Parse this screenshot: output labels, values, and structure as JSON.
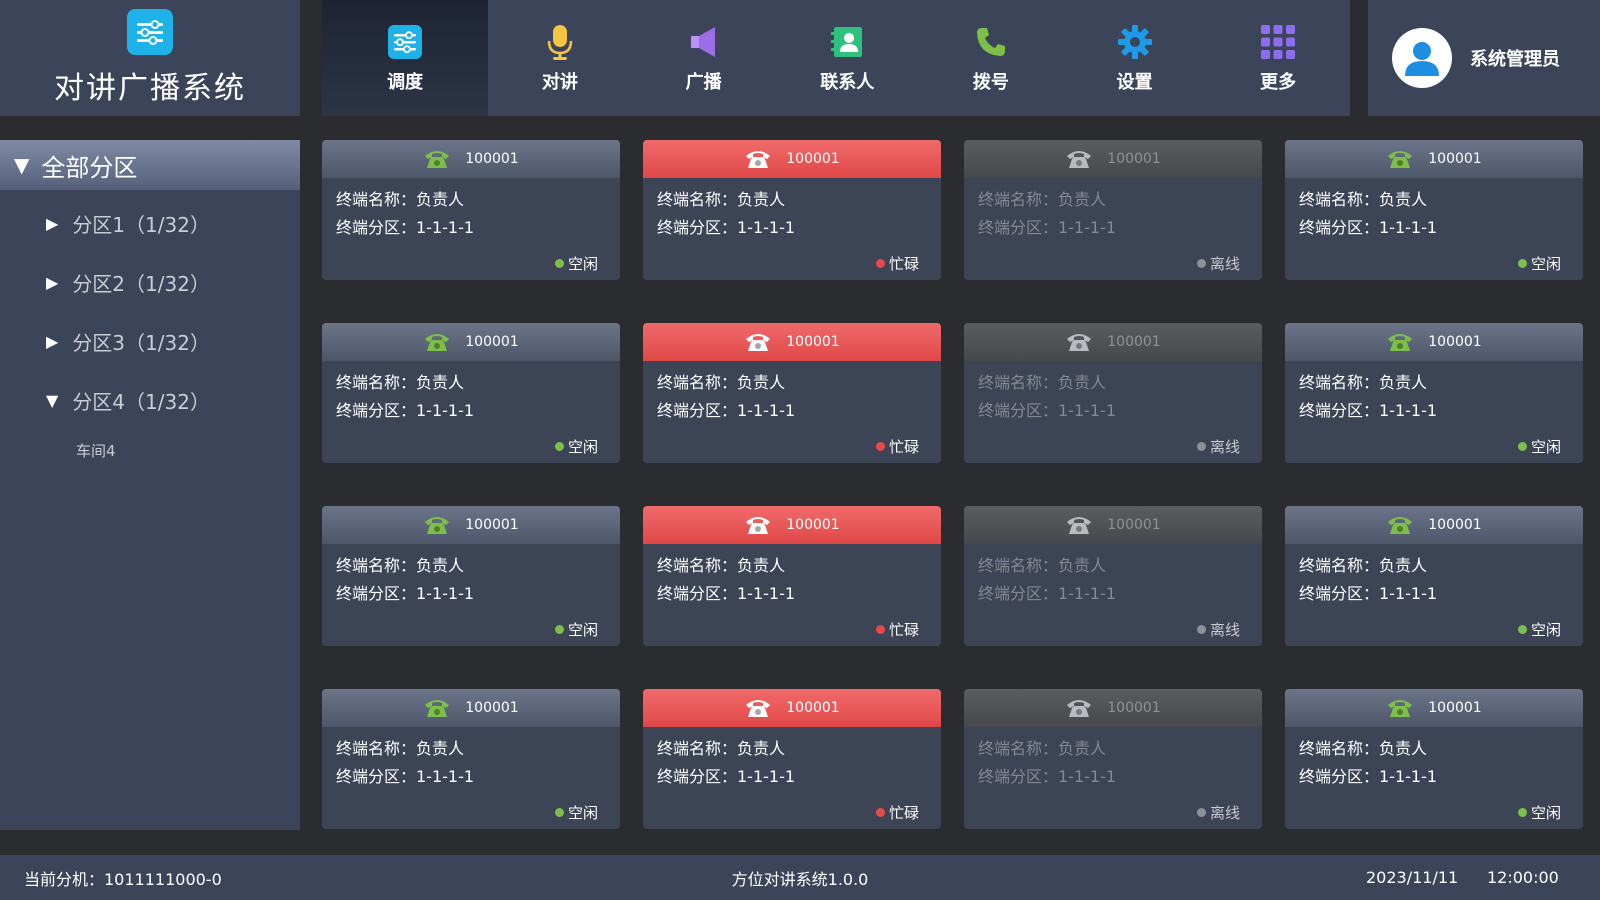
{
  "app": {
    "title": "对讲广播系统"
  },
  "nav": [
    {
      "label": "调度",
      "icon": "dispatch-icon",
      "active": true
    },
    {
      "label": "对讲",
      "icon": "microphone-icon"
    },
    {
      "label": "广播",
      "icon": "speaker-icon"
    },
    {
      "label": "联系人",
      "icon": "contacts-icon"
    },
    {
      "label": "拨号",
      "icon": "phone-dial-icon"
    },
    {
      "label": "设置",
      "icon": "gear-icon"
    },
    {
      "label": "更多",
      "icon": "grid-icon"
    }
  ],
  "user": {
    "name": "系统管理员",
    "icon": "user-avatar-icon"
  },
  "sidebar": {
    "root": "全部分区",
    "items": [
      {
        "label": "分区1（1/32）",
        "expanded": false
      },
      {
        "label": "分区2（1/32）",
        "expanded": false
      },
      {
        "label": "分区3（1/32）",
        "expanded": false
      },
      {
        "label": "分区4（1/32）",
        "expanded": true
      }
    ],
    "leaf": "车间4"
  },
  "cards": [
    {
      "id": "100001",
      "name_line": "终端名称：负责人",
      "zone_line": "终端分区：1-1-1-1",
      "status": "空闲",
      "state": "idle"
    },
    {
      "id": "100001",
      "name_line": "终端名称：负责人",
      "zone_line": "终端分区：1-1-1-1",
      "status": "忙碌",
      "state": "busy"
    },
    {
      "id": "100001",
      "name_line": "终端名称：负责人",
      "zone_line": "终端分区：1-1-1-1",
      "status": "离线",
      "state": "offline"
    },
    {
      "id": "100001",
      "name_line": "终端名称：负责人",
      "zone_line": "终端分区：1-1-1-1",
      "status": "空闲",
      "state": "idle"
    },
    {
      "id": "100001",
      "name_line": "终端名称：负责人",
      "zone_line": "终端分区：1-1-1-1",
      "status": "空闲",
      "state": "idle"
    },
    {
      "id": "100001",
      "name_line": "终端名称：负责人",
      "zone_line": "终端分区：1-1-1-1",
      "status": "忙碌",
      "state": "busy"
    },
    {
      "id": "100001",
      "name_line": "终端名称：负责人",
      "zone_line": "终端分区：1-1-1-1",
      "status": "离线",
      "state": "offline"
    },
    {
      "id": "100001",
      "name_line": "终端名称：负责人",
      "zone_line": "终端分区：1-1-1-1",
      "status": "空闲",
      "state": "idle"
    },
    {
      "id": "100001",
      "name_line": "终端名称：负责人",
      "zone_line": "终端分区：1-1-1-1",
      "status": "空闲",
      "state": "idle"
    },
    {
      "id": "100001",
      "name_line": "终端名称：负责人",
      "zone_line": "终端分区：1-1-1-1",
      "status": "忙碌",
      "state": "busy"
    },
    {
      "id": "100001",
      "name_line": "终端名称：负责人",
      "zone_line": "终端分区：1-1-1-1",
      "status": "离线",
      "state": "offline"
    },
    {
      "id": "100001",
      "name_line": "终端名称：负责人",
      "zone_line": "终端分区：1-1-1-1",
      "status": "空闲",
      "state": "idle"
    },
    {
      "id": "100001",
      "name_line": "终端名称：负责人",
      "zone_line": "终端分区：1-1-1-1",
      "status": "空闲",
      "state": "idle"
    },
    {
      "id": "100001",
      "name_line": "终端名称：负责人",
      "zone_line": "终端分区：1-1-1-1",
      "status": "忙碌",
      "state": "busy"
    },
    {
      "id": "100001",
      "name_line": "终端名称：负责人",
      "zone_line": "终端分区：1-1-1-1",
      "status": "离线",
      "state": "offline"
    },
    {
      "id": "100001",
      "name_line": "终端名称：负责人",
      "zone_line": "终端分区：1-1-1-1",
      "status": "空闲",
      "state": "idle"
    }
  ],
  "colors": {
    "idle": "#7cc04a",
    "busy": "#e84a4a",
    "offline": "#8e9096",
    "accent": "#1fb2e8"
  },
  "footer": {
    "current_ext": "当前分机：1011111000-0",
    "version": "方位对讲系统1.0.0",
    "date": "2023/11/11",
    "time": "12:00:00"
  }
}
